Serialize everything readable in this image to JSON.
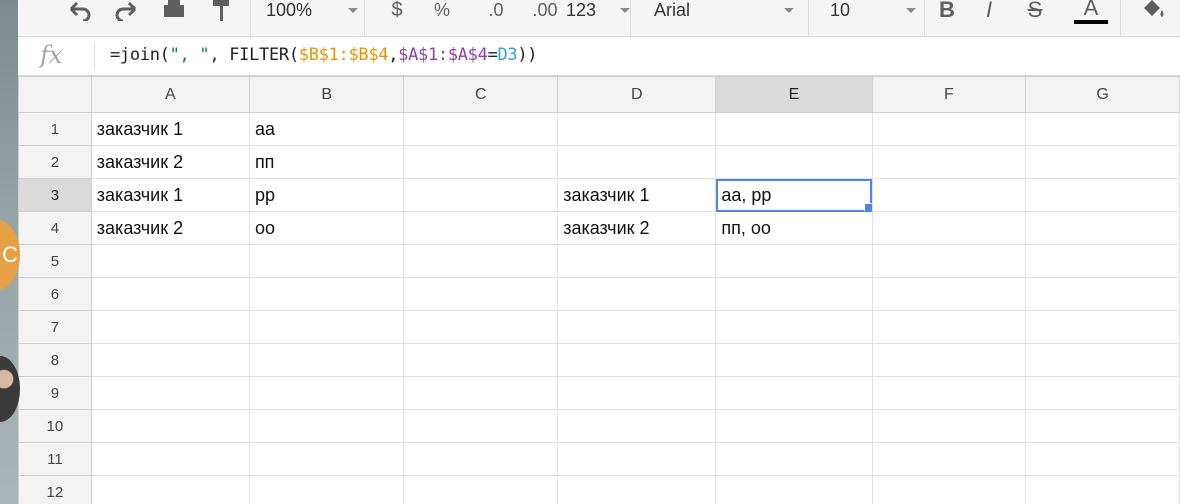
{
  "toolbar": {
    "zoom": "100%",
    "currency": "$",
    "percent": "%",
    "decrease_decimals": ".0",
    "increase_decimals": ".00",
    "number_format": "123",
    "font": "Arial",
    "font_size": "10",
    "bold": "B",
    "italic": "I",
    "strikethrough": "S",
    "text_color": "A",
    "icons": [
      "undo-icon",
      "redo-icon",
      "print-icon",
      "paint-format-icon",
      "paint-bucket-icon"
    ]
  },
  "formula_bar": {
    "label": "fx",
    "parts": [
      "=join(",
      "\", \"",
      ", FILTER(",
      "$B$1:$B$4",
      ",",
      "$A$1:$A$4",
      "=",
      "D3",
      "))"
    ]
  },
  "columns": [
    "A",
    "B",
    "C",
    "D",
    "E",
    "F",
    "G"
  ],
  "rows": [
    "1",
    "2",
    "3",
    "4",
    "5",
    "6",
    "7",
    "8",
    "9",
    "10",
    "11",
    "12"
  ],
  "cells": [
    [
      "заказчик 1",
      "аа",
      "",
      "",
      "",
      "",
      ""
    ],
    [
      "заказчик 2",
      "пп",
      "",
      "",
      "",
      "",
      ""
    ],
    [
      "заказчик 1",
      "рр",
      "",
      "заказчик 1",
      "аа, рр",
      "",
      ""
    ],
    [
      "заказчик 2",
      "оо",
      "",
      "заказчик 2",
      "пп, оо",
      "",
      ""
    ],
    [
      "",
      "",
      "",
      "",
      "",
      "",
      ""
    ],
    [
      "",
      "",
      "",
      "",
      "",
      "",
      ""
    ],
    [
      "",
      "",
      "",
      "",
      "",
      "",
      ""
    ],
    [
      "",
      "",
      "",
      "",
      "",
      "",
      ""
    ],
    [
      "",
      "",
      "",
      "",
      "",
      "",
      ""
    ],
    [
      "",
      "",
      "",
      "",
      "",
      "",
      ""
    ],
    [
      "",
      "",
      "",
      "",
      "",
      "",
      ""
    ],
    [
      "",
      "",
      "",
      "",
      "",
      "",
      ""
    ]
  ],
  "selected_cell": "E3",
  "left_badge": "C",
  "colors": {
    "selection": "#4a86e8",
    "formula_string": "#0a8a2a",
    "range_b": "#e69500",
    "range_a": "#8e3fb0",
    "ref_d3": "#2aa6c9"
  }
}
